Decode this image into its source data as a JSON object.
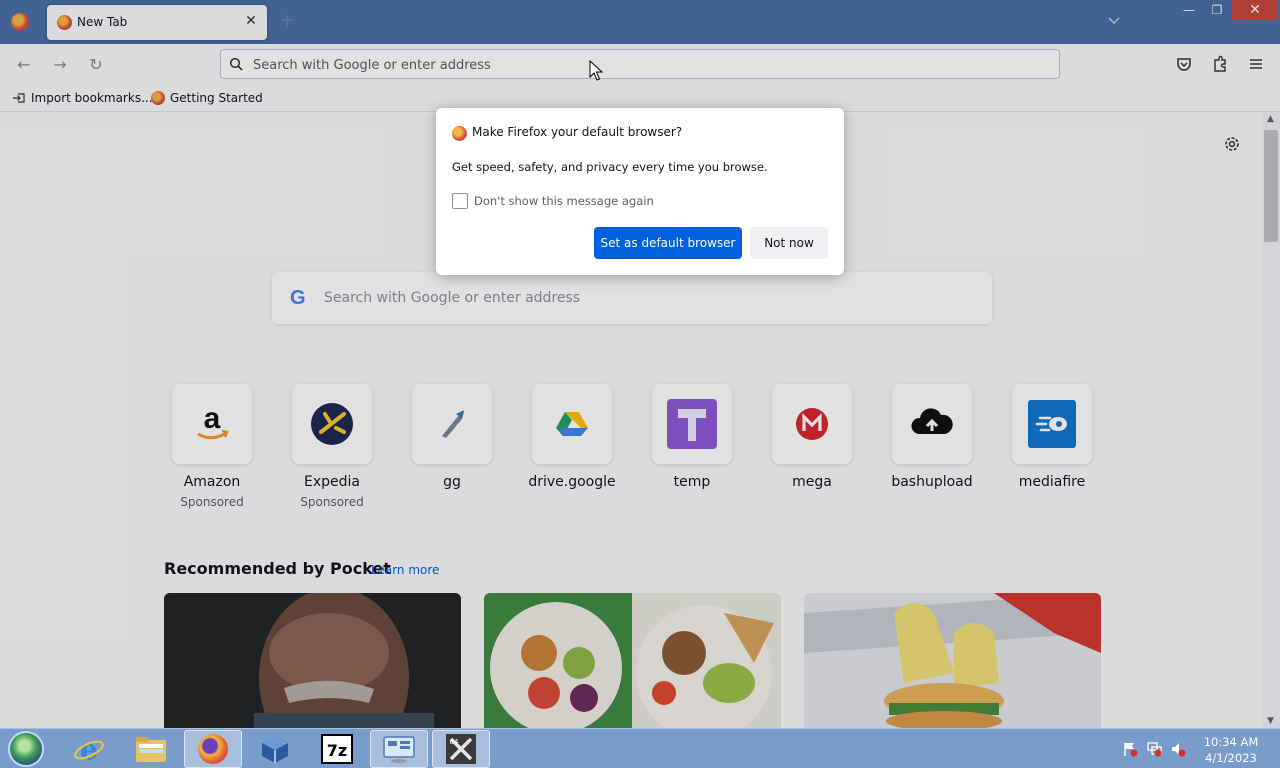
{
  "window": {
    "tab_title": "New Tab",
    "new_tab_glyph": "+",
    "close_glyph": "✕",
    "minimize_glyph": "—",
    "maximize_glyph": "❐"
  },
  "toolbar": {
    "url_placeholder": "Search with Google or enter address",
    "back_glyph": "←",
    "forward_glyph": "→",
    "reload_glyph": "↻"
  },
  "bookmarks": [
    {
      "label": "Import bookmarks...",
      "icon": "import-icon"
    },
    {
      "label": "Getting Started",
      "icon": "firefox-icon"
    }
  ],
  "newtab": {
    "search_placeholder": "Search with Google or enter address",
    "google_glyph": "G",
    "top_sites": [
      {
        "label": "Amazon",
        "sub": "Sponsored",
        "icon": "amazon-icon"
      },
      {
        "label": "Expedia",
        "sub": "Sponsored",
        "icon": "expedia-icon"
      },
      {
        "label": "gg",
        "sub": "",
        "icon": "gg-icon"
      },
      {
        "label": "drive.google",
        "sub": "",
        "icon": "google-drive-icon"
      },
      {
        "label": "temp",
        "sub": "",
        "icon": "temp-icon"
      },
      {
        "label": "mega",
        "sub": "",
        "icon": "mega-icon"
      },
      {
        "label": "bashupload",
        "sub": "",
        "icon": "bashupload-icon"
      },
      {
        "label": "mediafire",
        "sub": "",
        "icon": "mediafire-icon"
      }
    ],
    "pocket": {
      "title": "Recommended by Pocket",
      "learn_more": "Learn more"
    }
  },
  "dialog": {
    "title": "Make Firefox your default browser?",
    "body": "Get speed, safety, and privacy every time you browse.",
    "checkbox_label": "Don't show this message again",
    "primary_button": "Set as default browser",
    "secondary_button": "Not now"
  },
  "taskbar": {
    "time": "10:34 AM",
    "date": "4/1/2023",
    "apps": [
      "internet-explorer-icon",
      "file-explorer-icon",
      "firefox-icon",
      "virtualbox-icon",
      "7zip-icon",
      "control-panel-icon",
      "x64dbg-icon"
    ]
  },
  "colors": {
    "accent": "#0061e0",
    "titlebar": "#4a6fa5",
    "taskbar": "#7a9ccb"
  }
}
